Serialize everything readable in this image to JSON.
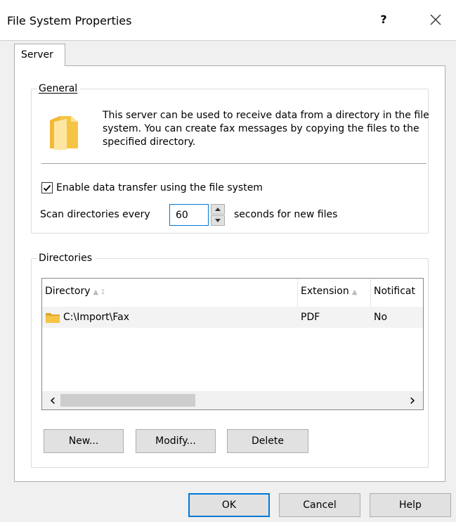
{
  "window": {
    "title": "File System Properties",
    "help_glyph": "?",
    "close_glyph": "✕"
  },
  "tabs": [
    {
      "label": "Server",
      "selected": true
    }
  ],
  "general": {
    "group_label": "General",
    "icon": "folder-icon",
    "description": "This server can be used to receive data from a directory in the file system. You can create fax messages by copying the files to the specified directory.",
    "enable_checkbox": {
      "label": "Enable data transfer using the file system",
      "checked": true
    },
    "scan": {
      "prefix": "Scan directories every",
      "value": "60",
      "suffix": "seconds for new files"
    }
  },
  "directories": {
    "group_label": "Directories",
    "columns": [
      {
        "label": "Directory",
        "sort": "▲ 1"
      },
      {
        "label": "Extension",
        "sort": "▲"
      },
      {
        "label": "Notificat",
        "sort": ""
      }
    ],
    "rows": [
      {
        "directory": "C:\\Import\\Fax",
        "extension": "PDF",
        "notification": "No",
        "icon": "folder-icon"
      }
    ],
    "scroll_left": "‹",
    "scroll_right": "›",
    "buttons": {
      "new": "New...",
      "modify": "Modify...",
      "delete": "Delete"
    }
  },
  "dialog_buttons": {
    "ok": "OK",
    "cancel": "Cancel",
    "help": "Help"
  },
  "colors": {
    "accent": "#0078d7",
    "folder": "#f6c445"
  }
}
